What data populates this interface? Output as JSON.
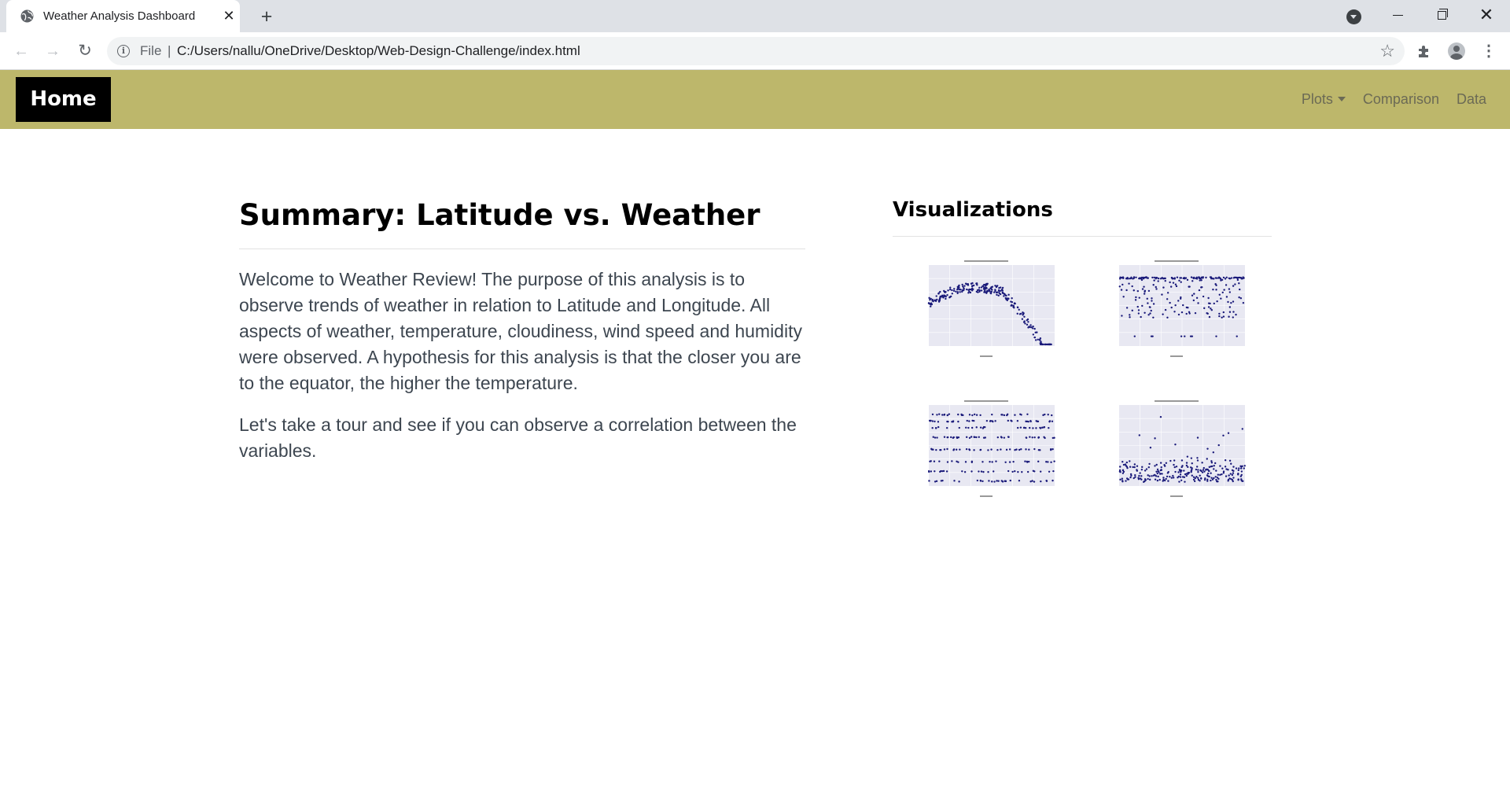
{
  "browser": {
    "tab_title": "Weather Analysis Dashboard",
    "new_tab_label": "+",
    "address_scheme": "File",
    "address_url": "C:/Users/nallu/OneDrive/Desktop/Web-Design-Challenge/index.html"
  },
  "navbar": {
    "brand": "Home",
    "links": [
      "Plots",
      "Comparison",
      "Data"
    ],
    "color": "#bdb76b"
  },
  "summary": {
    "title": "Summary: Latitude vs. Weather",
    "paragraphs": [
      "Welcome to Weather Review! The purpose of this analysis is to observe trends of weather in relation to Latitude and Longitude. All aspects of weather, temperature, cloudiness, wind speed and humidity were observed. A hypothesis for this analysis is that the closer you are to the equator, the higher the temperature.",
      "Let's take a tour and see if you can observe a correlation between the variables."
    ]
  },
  "visualizations": {
    "title": "Visualizations",
    "thumbnails": [
      {
        "name": "temperature-plot-thumbnail",
        "pattern": "arc"
      },
      {
        "name": "humidity-plot-thumbnail",
        "pattern": "top-band"
      },
      {
        "name": "cloudiness-plot-thumbnail",
        "pattern": "bands"
      },
      {
        "name": "wind-speed-plot-thumbnail",
        "pattern": "bottom-cluster"
      }
    ],
    "marker_color": "#1a1a7a",
    "plot_bg": "#e8e8f2"
  }
}
